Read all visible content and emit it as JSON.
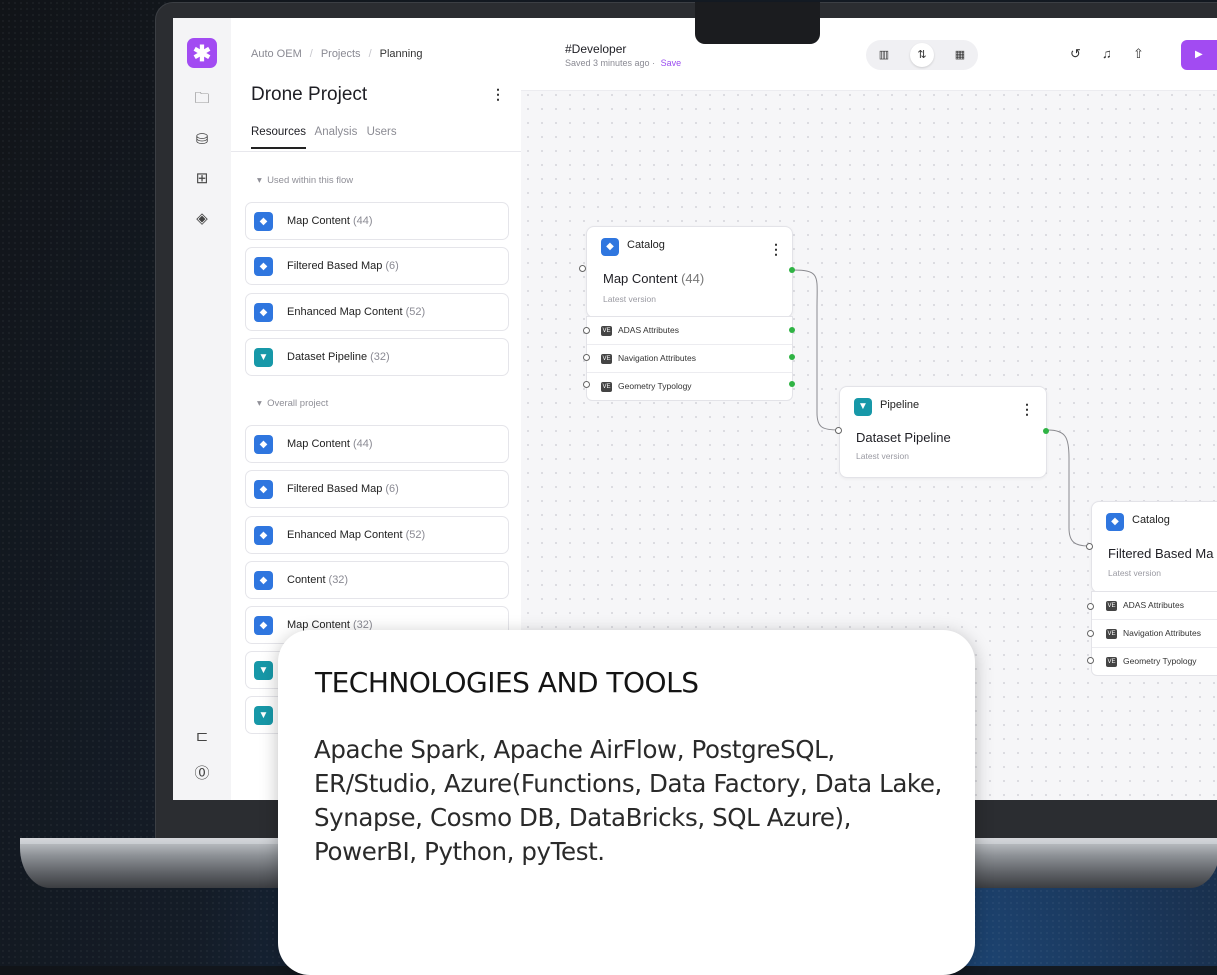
{
  "breadcrumb": [
    "Auto OEM",
    "Projects",
    "Planning"
  ],
  "project": {
    "title": "Drone Project"
  },
  "sidebar_tabs": [
    "Resources",
    "Analysis",
    "Users"
  ],
  "sections": {
    "used": "Used within this flow",
    "overall": "Overall project"
  },
  "used_items": [
    {
      "label": "Map Content",
      "count": "(44)",
      "kind": "catalog"
    },
    {
      "label": "Filtered Based Map",
      "count": "(6)",
      "kind": "catalog"
    },
    {
      "label": "Enhanced Map Content",
      "count": "(52)",
      "kind": "catalog"
    },
    {
      "label": "Dataset Pipeline",
      "count": "(32)",
      "kind": "pipeline"
    }
  ],
  "overall_items": [
    {
      "label": "Map Content",
      "count": "(44)",
      "kind": "catalog"
    },
    {
      "label": "Filtered Based Map",
      "count": "(6)",
      "kind": "catalog"
    },
    {
      "label": "Enhanced Map Content",
      "count": "(52)",
      "kind": "catalog"
    },
    {
      "label": "Content",
      "count": "(32)",
      "kind": "catalog"
    },
    {
      "label": "Map Content",
      "count": "(32)",
      "kind": "catalog"
    }
  ],
  "toolbar": {
    "doc_name": "#Developer",
    "saved_text": "Saved 3 minutes ago",
    "save_link": "Save",
    "view_icons": [
      "columns-icon",
      "flow-icon",
      "grid-icon"
    ],
    "action_icons": [
      "history-icon",
      "bell-icon",
      "share-icon",
      "play-icon"
    ]
  },
  "nodes": {
    "catalog1": {
      "type": "Catalog",
      "title": "Map Content",
      "count": "(44)",
      "subtitle": "Latest version",
      "attributes": [
        "ADAS Attributes",
        "Navigation Attributes",
        "Geometry Typology"
      ]
    },
    "pipeline": {
      "type": "Pipeline",
      "title": "Dataset Pipeline",
      "subtitle": "Latest version"
    },
    "catalog2": {
      "type": "Catalog",
      "title": "Filtered Based Ma",
      "subtitle": "Latest version",
      "attributes": [
        "ADAS Attributes",
        "Navigation Attributes",
        "Geometry Typology"
      ]
    }
  },
  "attr_chip": "VE",
  "icons": {
    "rail": [
      "folder-icon",
      "database-icon",
      "grid-icon",
      "layers-icon",
      "feedback-icon",
      "help-icon"
    ]
  },
  "colors": {
    "accent": "#a24bf2",
    "catalog": "#2f76df",
    "pipeline": "#1798a8",
    "port_out": "#2fb344"
  },
  "overlay": {
    "heading": "TECHNOLOGIES AND TOOLS",
    "body": "Apache Spark, Apache AirFlow, PostgreSQL, ER/Studio, Azure(Functions, Data Factory, Data Lake, Synapse, Cosmo DB, DataBricks, SQL Azure), PowerBI, Python, pyTest."
  }
}
